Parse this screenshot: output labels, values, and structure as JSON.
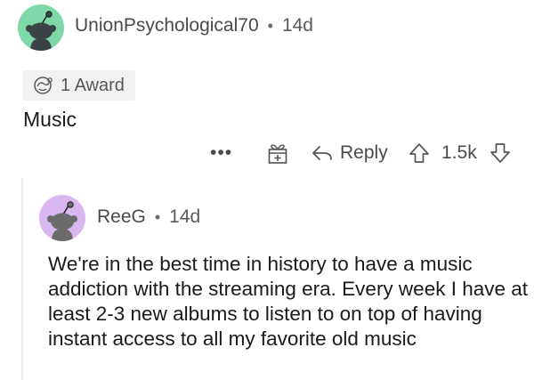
{
  "comments": [
    {
      "username": "UnionPsychological70",
      "separator": "•",
      "age": "14d",
      "award_label": "1 Award",
      "body": "Music",
      "actions": {
        "more_label": "•••",
        "reply_label": "Reply",
        "score": "1.5k"
      },
      "avatar_color": "#7ed8a8"
    },
    {
      "username": "ReeG",
      "separator": "•",
      "age": "14d",
      "body": "We're in the best time in history to have a music addiction with the streaming era. Every week I have at least 2-3 new albums to listen to on top of having instant access to all my favorite old music",
      "avatar_color": "#d9b8f2"
    }
  ],
  "icons": {
    "award": "award-icon",
    "gift": "gift-icon",
    "reply": "reply-arrow-icon",
    "upvote": "upvote-arrow-icon",
    "downvote": "downvote-arrow-icon",
    "avatar": "snoo-avatar-icon"
  }
}
